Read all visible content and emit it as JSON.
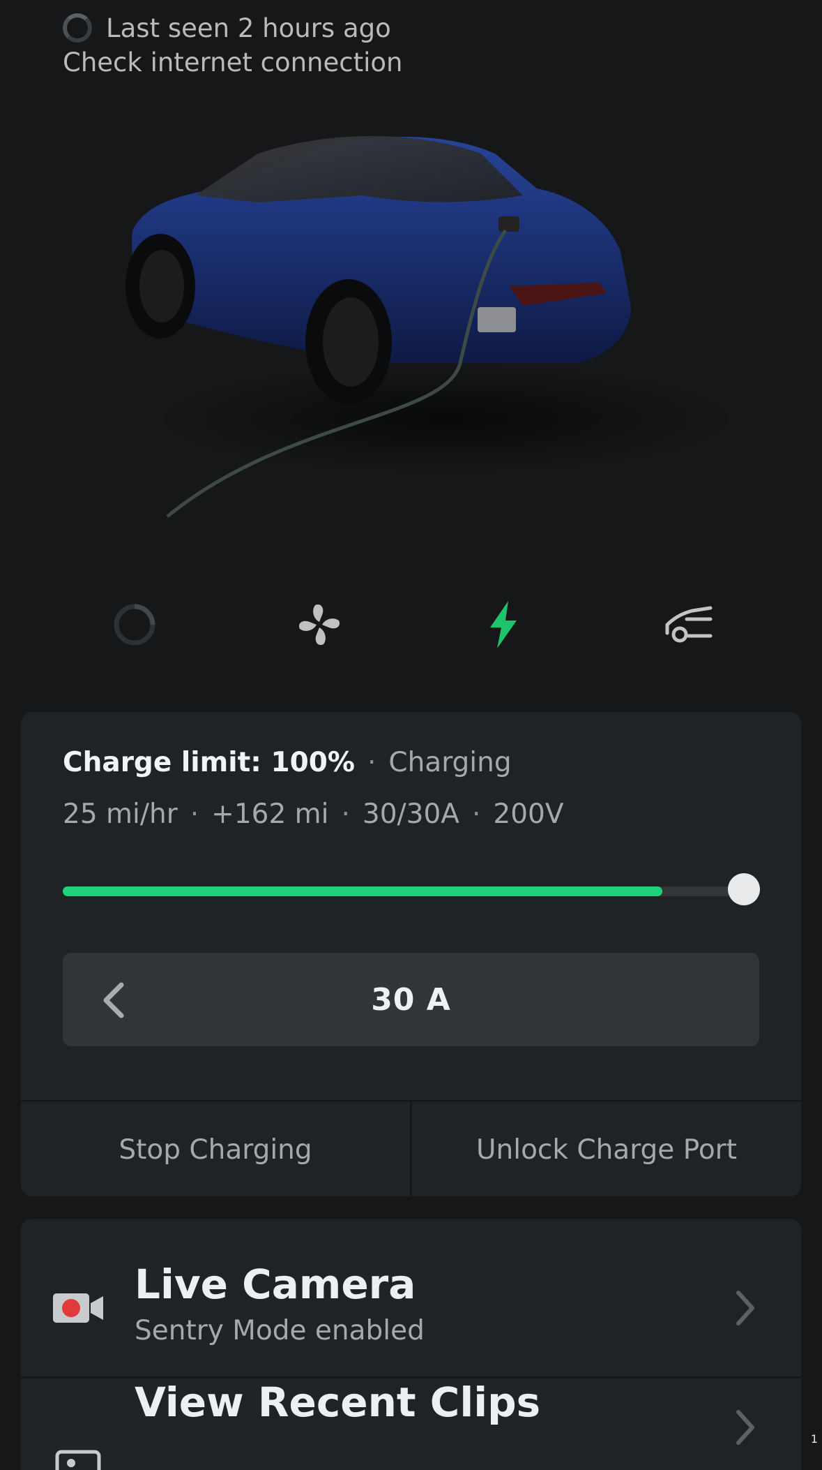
{
  "status": {
    "last_seen": "Last seen 2 hours ago",
    "check_connection": "Check internet connection"
  },
  "quick_actions": [
    {
      "icon": "loading-spinner-icon"
    },
    {
      "icon": "fan-icon"
    },
    {
      "icon": "lightning-bolt-icon",
      "color": "#1ec46c"
    },
    {
      "icon": "car-trunk-icon"
    }
  ],
  "charging": {
    "limit_label": "Charge limit: 100%",
    "status": "Charging",
    "rate": "25 mi/hr",
    "added": "+162 mi",
    "current": "30/30A",
    "voltage": "200V",
    "charge_level_fraction": 0.86,
    "limit_fraction": 1.0,
    "amps_value": "30 A",
    "stop_label": "Stop Charging",
    "unlock_label": "Unlock Charge Port",
    "accent_color": "#1ed37a"
  },
  "menu": {
    "live_camera": {
      "title": "Live Camera",
      "subtitle": "Sentry Mode enabled",
      "icon": "camera-icon"
    },
    "recent_clips": {
      "title": "View Recent Clips",
      "icon": "image-icon"
    }
  },
  "corner_text": "1"
}
